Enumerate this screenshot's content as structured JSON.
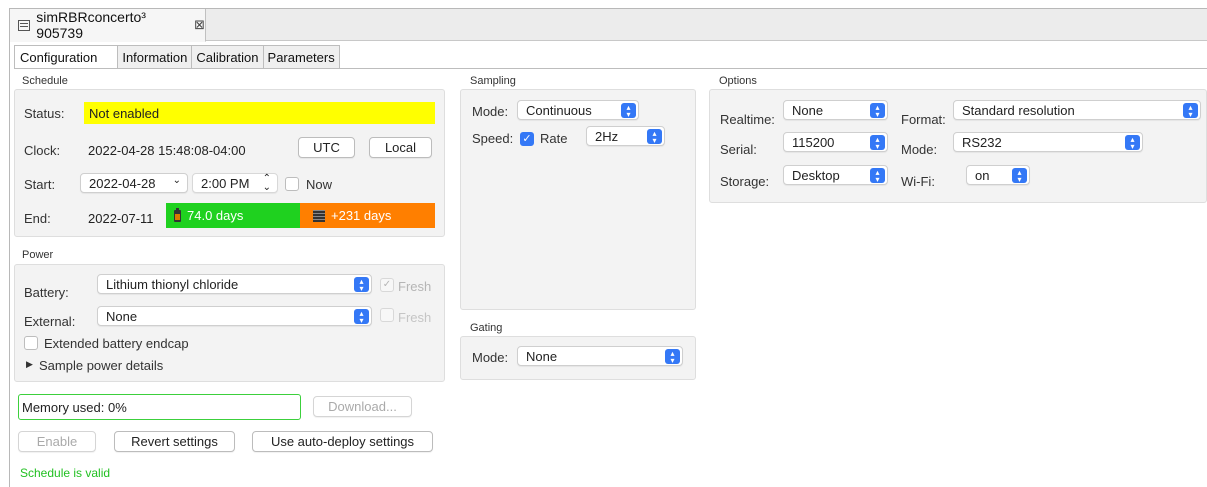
{
  "editor": {
    "tab_title": "simRBRconcerto³ 905739",
    "close_glyph": "⊠",
    "doc_icon": "document-icon"
  },
  "tabs": [
    {
      "label": "Configuration",
      "active": true
    },
    {
      "label": "Information",
      "active": false
    },
    {
      "label": "Calibration",
      "active": false
    },
    {
      "label": "Parameters",
      "active": false
    }
  ],
  "schedule": {
    "group_label": "Schedule",
    "status_label": "Status:",
    "status_value": "Not enabled",
    "status_color": "#ffff00",
    "clock_label": "Clock:",
    "clock_value": "2022-04-28 15:48:08-04:00",
    "utc_button": "UTC",
    "local_button": "Local",
    "start_label": "Start:",
    "start_date": "2022-04-28",
    "start_time": "2:00 PM",
    "now_label": "Now",
    "now_checked": false,
    "end_label": "End:",
    "end_date": "2022-07-11",
    "battery_days": "74.0 days",
    "memory_days": "+231 days",
    "battery_color": "#1fd11f",
    "memory_color": "#ff7f00"
  },
  "power": {
    "group_label": "Power",
    "battery_label": "Battery:",
    "battery_value": "Lithium thionyl chloride",
    "fresh_label": "Fresh",
    "battery_fresh_checked": true,
    "external_label": "External:",
    "external_value": "None",
    "external_fresh_checked": false,
    "endcap_label": "Extended battery endcap",
    "endcap_checked": false,
    "details_label": "Sample power details"
  },
  "sampling": {
    "group_label": "Sampling",
    "mode_label": "Mode:",
    "mode_value": "Continuous",
    "speed_label": "Speed:",
    "rate_label": "Rate",
    "rate_checked": true,
    "rate_value": "2Hz"
  },
  "gating": {
    "group_label": "Gating",
    "mode_label": "Mode:",
    "mode_value": "None"
  },
  "options": {
    "group_label": "Options",
    "realtime_label": "Realtime:",
    "realtime_value": "None",
    "format_label": "Format:",
    "format_value": "Standard resolution",
    "serial_label": "Serial:",
    "serial_value": "115200",
    "mode_label": "Mode:",
    "mode_value": "RS232",
    "storage_label": "Storage:",
    "storage_value": "Desktop",
    "wifi_label": "Wi-Fi:",
    "wifi_value": "on"
  },
  "footer": {
    "memory_used": "Memory used: 0%",
    "download_button": "Download...",
    "enable_button": "Enable",
    "revert_button": "Revert settings",
    "autodeploy_button": "Use auto-deploy settings",
    "valid_text": "Schedule is valid",
    "valid_color": "#22c022"
  },
  "colors": {
    "accent": "#3478f6"
  }
}
